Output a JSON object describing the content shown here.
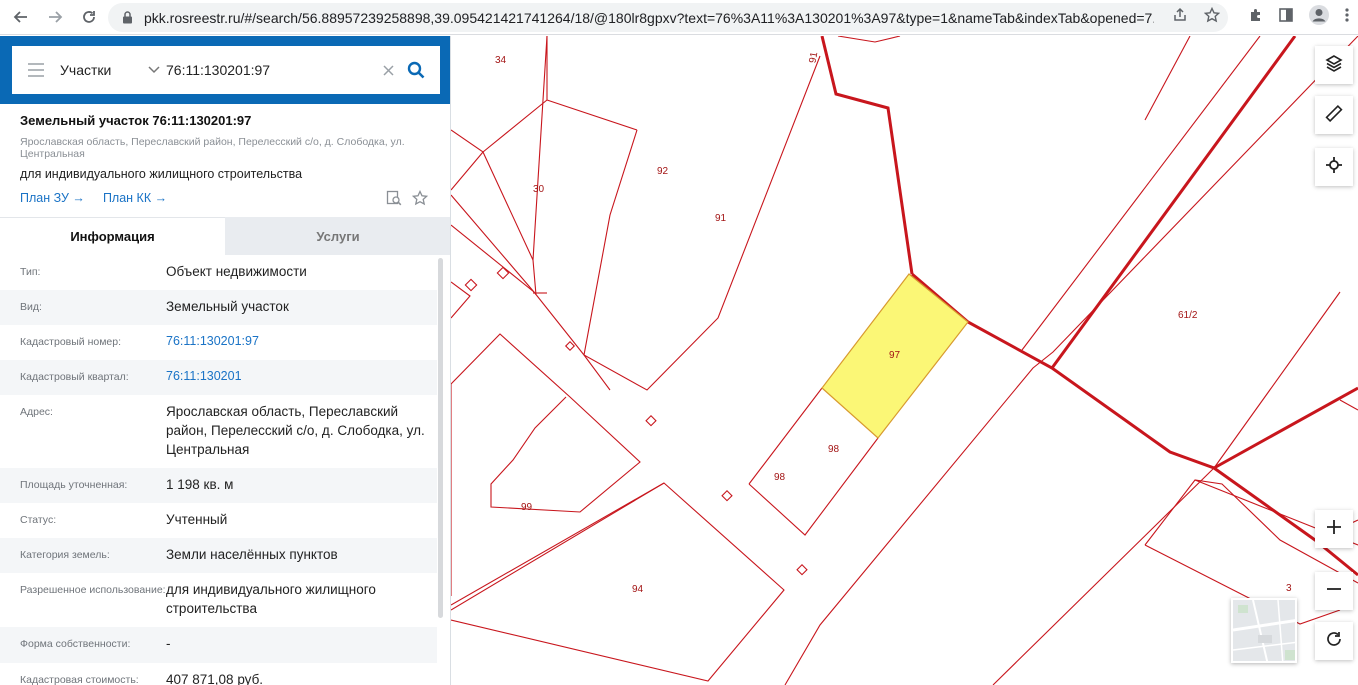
{
  "browser": {
    "url": "pkk.rosreestr.ru/#/search/56.88957239258898,39.095421421741264/18/@180lr8gpxv?text=76%3A11%3A130201%3A97&type=1&nameTab&indexTab&opened=7..."
  },
  "search": {
    "type_label": "Участки",
    "query": "76:11:130201:97"
  },
  "object": {
    "title": "Земельный участок 76:11:130201:97",
    "address": "Ярославская область, Переславский район, Перелесский с/о, д. Слободка, ул. Центральная",
    "use": "для индивидуального жилищного строительства",
    "plan_zu": "План ЗУ →",
    "plan_kk": "План КК →"
  },
  "tabs": {
    "info": "Информация",
    "services": "Услуги"
  },
  "rows": [
    {
      "label": "Тип:",
      "value": "Объект недвижимости"
    },
    {
      "label": "Вид:",
      "value": "Земельный участок"
    },
    {
      "label": "Кадастровый номер:",
      "value": "76:11:130201:97"
    },
    {
      "label": "Кадастровый квартал:",
      "value": "76:11:130201"
    },
    {
      "label": "Адрес:",
      "value": "Ярославская область, Переславский район, Перелесский с/о, д. Слободка, ул. Центральная"
    },
    {
      "label": "Площадь уточненная:",
      "value": "1 198 кв. м"
    },
    {
      "label": "Статус:",
      "value": "Учтенный"
    },
    {
      "label": "Категория земель:",
      "value": "Земли населённых пунктов"
    },
    {
      "label": "Разрешенное использование:",
      "value": "для индивидуального жилищного строительства"
    },
    {
      "label": "Форма собственности:",
      "value": "-"
    },
    {
      "label": "Кадастровая стоимость:",
      "value": "407 871,08 руб."
    }
  ],
  "map": {
    "labels": {
      "p34": "34",
      "p91top": "91",
      "p30": "30",
      "p92": "92",
      "p91": "91",
      "p97": "97",
      "p98a": "98",
      "p98b": "98",
      "p99": "99",
      "p94": "94",
      "p61_2": "61/2",
      "p3": "3"
    },
    "colors": {
      "boundary": "#c8161d",
      "selected_fill": "#fbf776",
      "label": "#a31515"
    }
  },
  "colors": {
    "header": "#0a69b5",
    "link": "#1a73c6"
  },
  "icons": {
    "back": "arrow-left-icon",
    "forward": "arrow-right-icon",
    "reload": "reload-icon",
    "lock": "lock-icon",
    "share": "share-icon",
    "bookmark": "star-icon",
    "extensions": "puzzle-icon",
    "sidepanel": "sidepanel-icon",
    "profile": "profile-icon",
    "menu": "kebab-icon",
    "layers": "layers-icon",
    "ruler": "ruler-icon",
    "locate": "crosshair-icon",
    "zoom_in": "plus-icon",
    "zoom_out": "minus-icon",
    "rotate": "rotate-icon"
  }
}
